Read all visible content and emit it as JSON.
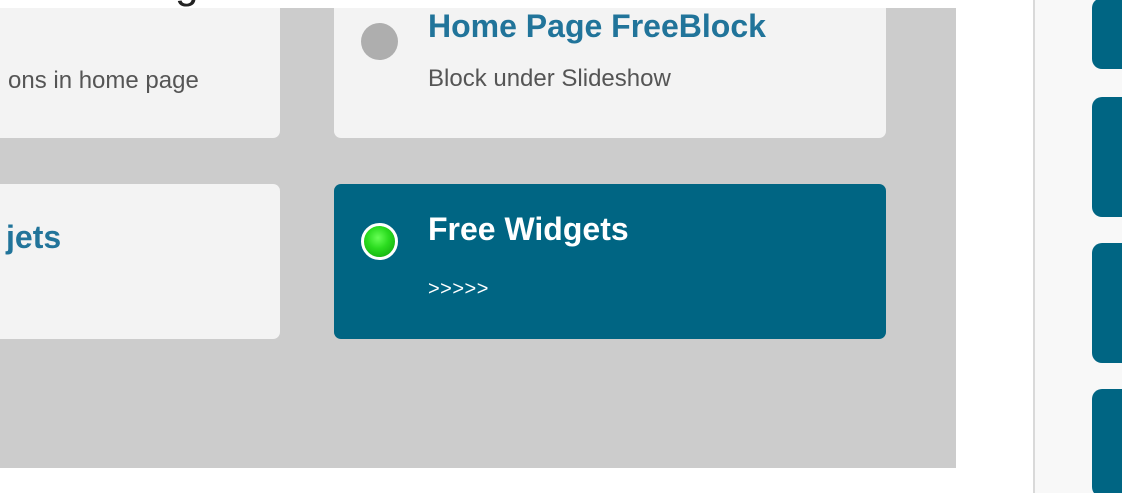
{
  "top_text": "Home Page FreeBlock...",
  "cards": [
    {
      "title": "",
      "subtitle": "ons in home page"
    },
    {
      "title": "Home Page FreeBlock",
      "subtitle": "Block under Slideshow",
      "status_icon": "status-dot-gray-icon"
    },
    {
      "title": "jets",
      "subtitle": ""
    },
    {
      "title": "Free Widgets",
      "subtitle": ">>>>>",
      "status_icon": "status-dot-green-icon",
      "active": true
    }
  ],
  "colors": {
    "panel_background": "#cccccc",
    "card_background": "#f3f3f3",
    "accent_blue": "#006583",
    "title_blue": "#21749a",
    "active_text": "#ffffff",
    "inactive_dot": "#aeaeae",
    "active_dot": "#2bdc1f"
  }
}
